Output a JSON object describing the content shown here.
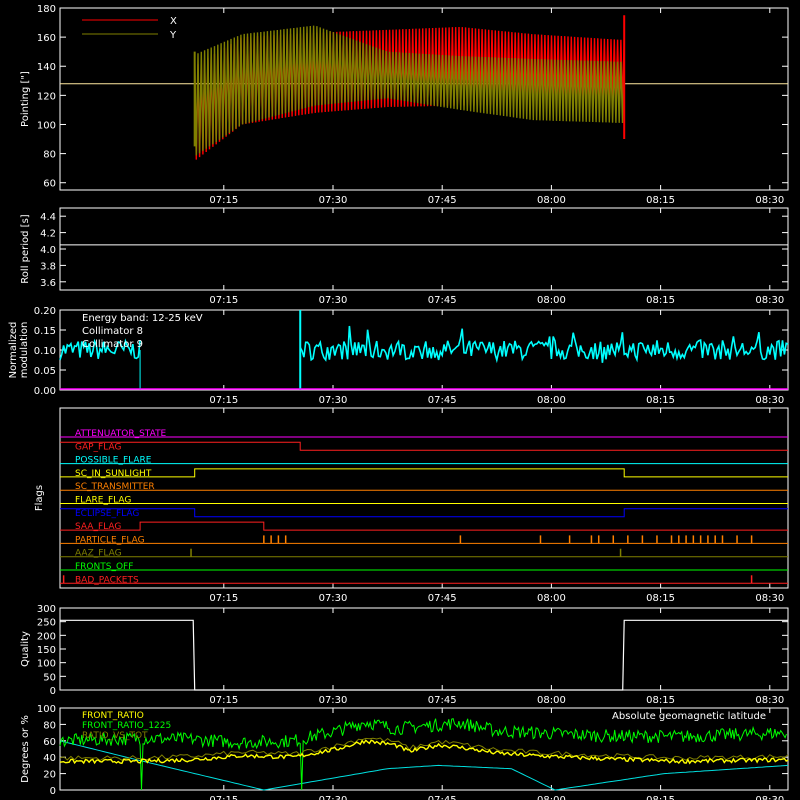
{
  "time_axis": {
    "tick_labels": [
      "07:15",
      "07:30",
      "07:45",
      "08:00",
      "08:15",
      "08:30"
    ],
    "range_minutes": [
      0,
      100
    ],
    "tick_minutes": [
      22.5,
      37.5,
      52.5,
      67.5,
      82.5,
      97.5
    ]
  },
  "chart_data": [
    {
      "id": "pointing",
      "type": "line",
      "ylabel": "Pointing [\"]",
      "ylim": [
        55,
        180
      ],
      "yticks": [
        60,
        80,
        100,
        120,
        140,
        160,
        180
      ],
      "series": [
        {
          "name": "X",
          "color": "#ff0000"
        },
        {
          "name": "Y",
          "color": "#808000"
        }
      ],
      "reference_level": 128,
      "reference_color": "#ffe9a0",
      "active_range_minutes": [
        18.5,
        77.5
      ],
      "x_envelope": {
        "t": [
          18.5,
          25,
          35,
          45,
          55,
          65,
          77.5
        ],
        "upper": [
          140,
          160,
          163,
          165,
          167,
          162,
          158
        ],
        "lower": [
          75,
          100,
          108,
          112,
          113,
          114,
          113
        ]
      },
      "y_envelope": {
        "t": [
          18.5,
          25,
          35,
          45,
          55,
          65,
          77.5
        ],
        "upper": [
          148,
          162,
          168,
          150,
          147,
          145,
          143
        ],
        "lower": [
          78,
          100,
          113,
          118,
          110,
          103,
          101
        ]
      }
    },
    {
      "id": "roll_period",
      "type": "line",
      "ylabel": "Roll period [s]",
      "ylim": [
        3.5,
        4.5
      ],
      "yticks": [
        3.6,
        3.8,
        4.0,
        4.2,
        4.4
      ],
      "series": [
        {
          "name": "",
          "color": "#ffffff",
          "constant": 4.05
        }
      ]
    },
    {
      "id": "modulation",
      "type": "line",
      "ylabel_lines": [
        "Normalized",
        "modulation"
      ],
      "ylim": [
        0,
        0.2
      ],
      "yticks": [
        0.0,
        0.05,
        0.1,
        0.15,
        0.2
      ],
      "annotation": "Energy band: 12-25 keV",
      "series": [
        {
          "name": "Collimator 8",
          "color": "#00ffff",
          "level": 0.1,
          "segments_minutes": [
            [
              0,
              11
            ],
            [
              33,
              100
            ]
          ],
          "spike_minutes": 33,
          "spike_value": 0.2
        },
        {
          "name": "Collimator 9",
          "color": "#ff00ff",
          "constant": 0.0
        }
      ]
    },
    {
      "id": "flags",
      "type": "line",
      "ylabel": "Flags",
      "flags": [
        {
          "name": "ATTENUATOR_STATE",
          "color": "#ff00ff",
          "steps": [
            [
              0,
              0
            ],
            [
              100,
              0
            ]
          ]
        },
        {
          "name": "GAP_FLAG",
          "color": "#ff2020",
          "steps": [
            [
              0,
              1
            ],
            [
              33,
              0
            ],
            [
              100,
              0
            ]
          ]
        },
        {
          "name": "POSSIBLE_FLARE",
          "color": "#00ffff",
          "steps": [
            [
              0,
              0
            ],
            [
              100,
              0
            ]
          ]
        },
        {
          "name": "SC_IN_SUNLIGHT",
          "color": "#ffff00",
          "steps": [
            [
              0,
              0
            ],
            [
              18.5,
              1
            ],
            [
              77.5,
              0
            ],
            [
              100,
              0
            ]
          ]
        },
        {
          "name": "SC_TRANSMITTER",
          "color": "#ff8000",
          "steps": [
            [
              0,
              0
            ],
            [
              100,
              0
            ]
          ]
        },
        {
          "name": "FLARE_FLAG",
          "color": "#ffff00",
          "steps": [
            [
              0,
              0
            ],
            [
              100,
              0
            ]
          ]
        },
        {
          "name": "ECLIPSE_FLAG",
          "color": "#0000ff",
          "steps": [
            [
              0,
              1
            ],
            [
              18.5,
              0
            ],
            [
              77.5,
              1
            ],
            [
              100,
              1
            ]
          ]
        },
        {
          "name": "SAA_FLAG",
          "color": "#ff2020",
          "steps": [
            [
              0,
              0
            ],
            [
              11,
              1
            ],
            [
              28,
              0
            ],
            [
              100,
              0
            ]
          ]
        },
        {
          "name": "PARTICLE_FLAG",
          "color": "#ff8000",
          "spikes_minutes": [
            28,
            29,
            30,
            31,
            55,
            66,
            70,
            73,
            74,
            76,
            78,
            80,
            82,
            84,
            85,
            86,
            87,
            88,
            89,
            90,
            91,
            93,
            95
          ]
        },
        {
          "name": "AAZ_FLAG",
          "color": "#808000",
          "spikes_minutes": [
            18,
            77
          ]
        },
        {
          "name": "FRONTS_OFF",
          "color": "#00ff00",
          "steps": [
            [
              0,
              0
            ],
            [
              100,
              0
            ]
          ]
        },
        {
          "name": "BAD_PACKETS",
          "color": "#ff2020",
          "spikes_minutes": [
            0.5,
            95
          ]
        }
      ]
    },
    {
      "id": "quality",
      "type": "line",
      "ylabel": "Quality",
      "ylim": [
        0,
        300
      ],
      "yticks": [
        0,
        50,
        100,
        150,
        200,
        250,
        300
      ],
      "series": [
        {
          "name": "",
          "color": "#ffffff",
          "points_minutes": [
            [
              0,
              255
            ],
            [
              18.3,
              255
            ],
            [
              18.5,
              0
            ],
            [
              77.3,
              0
            ],
            [
              77.5,
              255
            ],
            [
              100,
              255
            ]
          ]
        }
      ]
    },
    {
      "id": "ratios",
      "type": "line",
      "ylabel": "Degrees or %",
      "ylim": [
        0,
        100
      ],
      "yticks": [
        0,
        20,
        40,
        60,
        80,
        100
      ],
      "series": [
        {
          "name": "FRONT_RATIO",
          "color": "#ffff00"
        },
        {
          "name": "FRONT_RATIO_1225",
          "color": "#00ff00"
        },
        {
          "name": "RATIO_VS_TOT",
          "color": "#808000"
        },
        {
          "name": "Absolute geomagnetic latitude",
          "color": "#00e0e0"
        }
      ],
      "front_ratio_curve": {
        "t": [
          0,
          11,
          18,
          25,
          32,
          38,
          42,
          46,
          48,
          52,
          55,
          60,
          65,
          75,
          85,
          100
        ],
        "v": [
          35,
          35,
          37,
          42,
          40,
          50,
          60,
          55,
          47,
          55,
          52,
          45,
          42,
          38,
          35,
          37
        ]
      },
      "front_1225_curve": {
        "t": [
          0,
          11,
          18,
          25,
          32,
          38,
          42,
          46,
          50,
          55,
          60,
          65,
          75,
          85,
          100
        ],
        "v": [
          60,
          63,
          62,
          58,
          60,
          72,
          83,
          75,
          78,
          82,
          72,
          70,
          66,
          65,
          70
        ]
      },
      "latitude_curve": {
        "t": [
          0,
          10,
          28,
          45,
          52,
          62,
          68,
          83,
          100
        ],
        "v": [
          60,
          38,
          0,
          26,
          30,
          26,
          0,
          20,
          30
        ]
      }
    }
  ]
}
